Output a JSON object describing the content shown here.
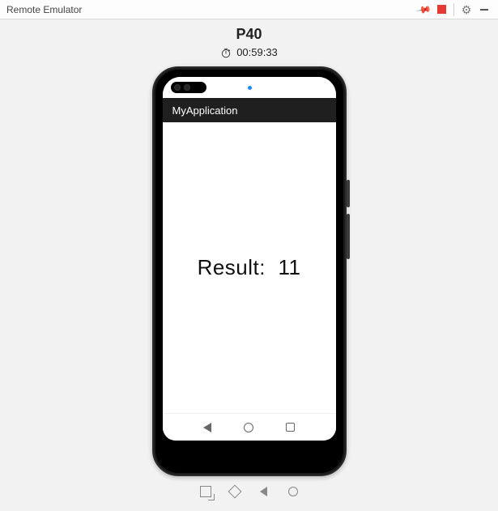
{
  "window": {
    "title": "Remote Emulator"
  },
  "device": {
    "name": "P40",
    "timer": "00:59:33"
  },
  "app": {
    "title": "MyApplication",
    "result_label": "Result:",
    "result_value": "11"
  }
}
